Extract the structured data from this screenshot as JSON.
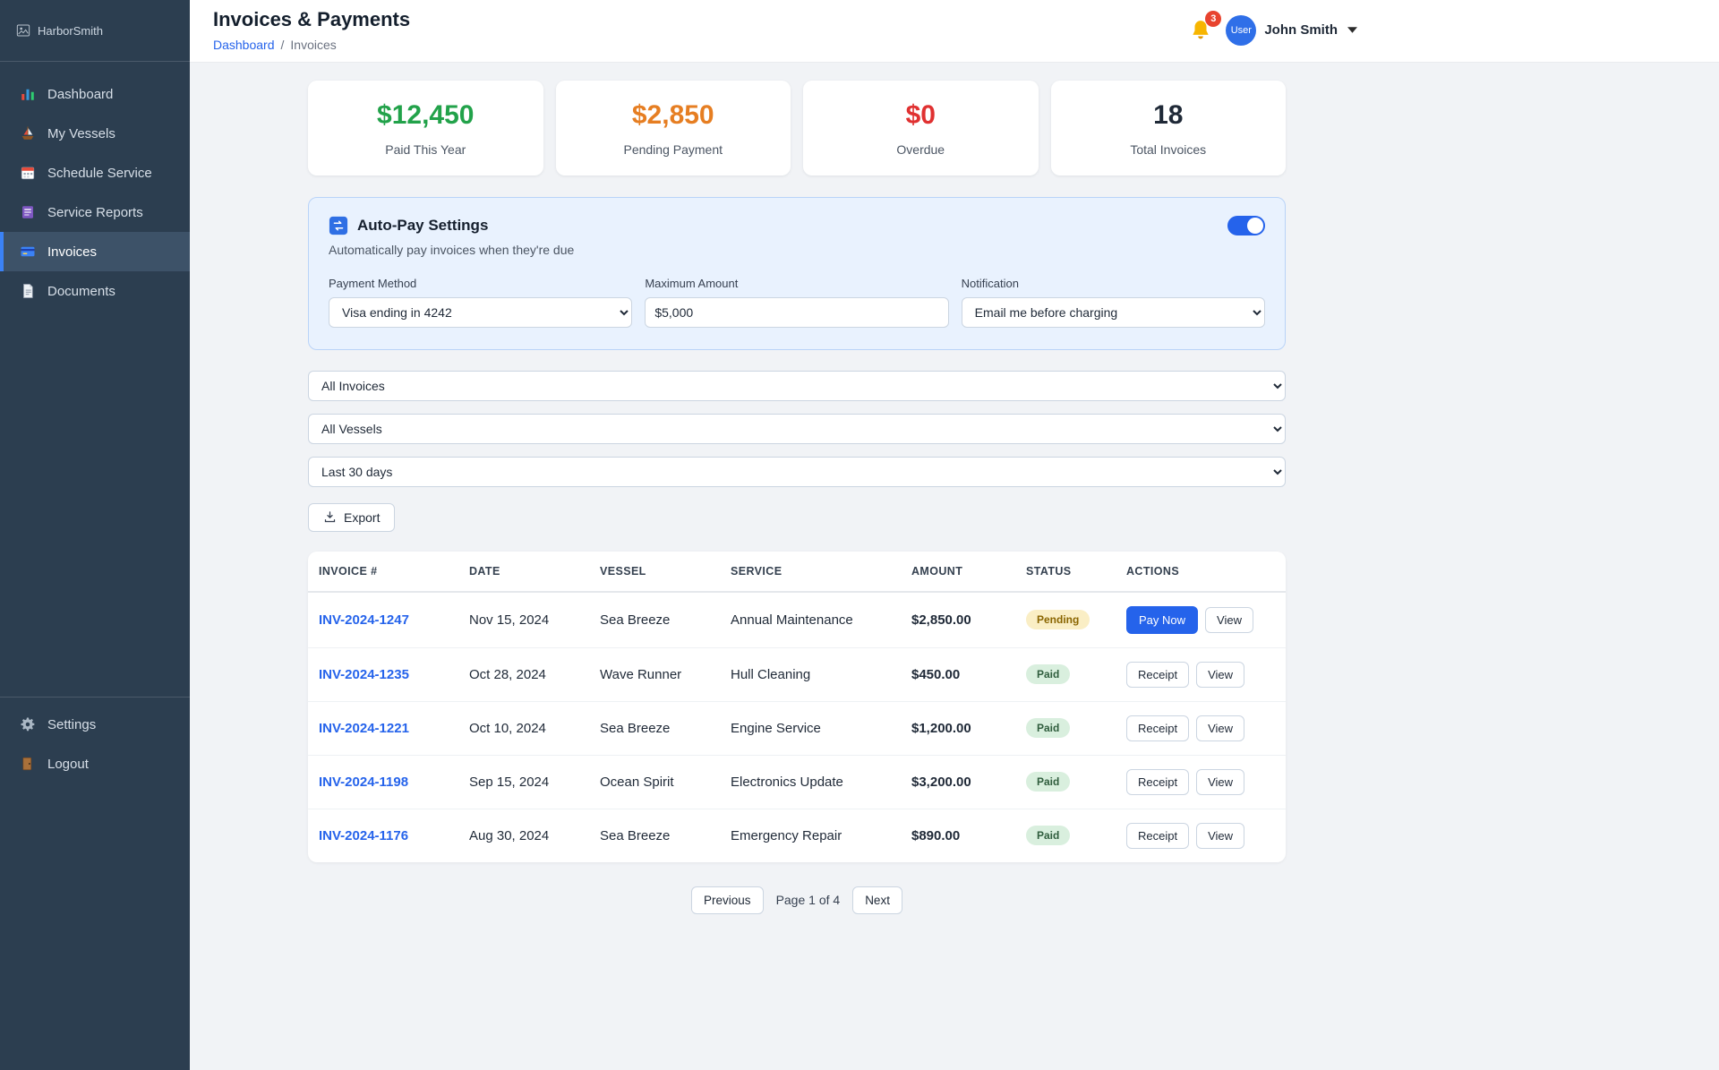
{
  "brand": {
    "name": "HarborSmith"
  },
  "header": {
    "title": "Invoices & Payments",
    "breadcrumb": {
      "link": "Dashboard",
      "separator": "/",
      "current": "Invoices"
    },
    "notification_count": "3",
    "user_name": "John Smith",
    "avatar_text": "User"
  },
  "sidebar": {
    "items": [
      {
        "label": "Dashboard",
        "icon": "dashboard-icon",
        "active": false
      },
      {
        "label": "My Vessels",
        "icon": "vessel-icon",
        "active": false
      },
      {
        "label": "Schedule Service",
        "icon": "calendar-icon",
        "active": false
      },
      {
        "label": "Service Reports",
        "icon": "report-icon",
        "active": false
      },
      {
        "label": "Invoices",
        "icon": "invoice-icon",
        "active": true
      },
      {
        "label": "Documents",
        "icon": "document-icon",
        "active": false
      }
    ],
    "footer_items": [
      {
        "label": "Settings",
        "icon": "gear-icon",
        "active": false
      },
      {
        "label": "Logout",
        "icon": "door-icon",
        "active": false
      }
    ]
  },
  "stats": [
    {
      "value": "$12,450",
      "label": "Paid This Year",
      "color": "#22a24a"
    },
    {
      "value": "$2,850",
      "label": "Pending Payment",
      "color": "#e67e22"
    },
    {
      "value": "$0",
      "label": "Overdue",
      "color": "#e03131"
    },
    {
      "value": "18",
      "label": "Total Invoices",
      "color": "#1f2937"
    }
  ],
  "autopay": {
    "title": "Auto-Pay Settings",
    "subtitle": "Automatically pay invoices when they're due",
    "toggle_on": true,
    "fields": [
      {
        "label": "Payment Method",
        "type": "select",
        "value": "Visa ending in 4242"
      },
      {
        "label": "Maximum Amount",
        "type": "input",
        "value": "$5,000"
      },
      {
        "label": "Notification",
        "type": "select",
        "value": "Email me before charging"
      }
    ]
  },
  "filters": [
    {
      "name": "invoice-status-filter",
      "value": "All Invoices"
    },
    {
      "name": "vessel-filter",
      "value": "All Vessels"
    },
    {
      "name": "date-range-filter",
      "value": "Last 30 days"
    }
  ],
  "export_label": "Export",
  "invoice_table": {
    "columns": [
      "INVOICE #",
      "DATE",
      "VESSEL",
      "SERVICE",
      "AMOUNT",
      "STATUS",
      "ACTIONS"
    ],
    "rows": [
      {
        "invoice": "INV-2024-1247",
        "date": "Nov 15, 2024",
        "vessel": "Sea Breeze",
        "service": "Annual Maintenance",
        "amount": "$2,850.00",
        "status": "Pending",
        "actions": [
          {
            "label": "Pay Now",
            "variant": "primary"
          },
          {
            "label": "View",
            "variant": "default"
          }
        ]
      },
      {
        "invoice": "INV-2024-1235",
        "date": "Oct 28, 2024",
        "vessel": "Wave Runner",
        "service": "Hull Cleaning",
        "amount": "$450.00",
        "status": "Paid",
        "actions": [
          {
            "label": "Receipt",
            "variant": "default"
          },
          {
            "label": "View",
            "variant": "default"
          }
        ]
      },
      {
        "invoice": "INV-2024-1221",
        "date": "Oct 10, 2024",
        "vessel": "Sea Breeze",
        "service": "Engine Service",
        "amount": "$1,200.00",
        "status": "Paid",
        "actions": [
          {
            "label": "Receipt",
            "variant": "default"
          },
          {
            "label": "View",
            "variant": "default"
          }
        ]
      },
      {
        "invoice": "INV-2024-1198",
        "date": "Sep 15, 2024",
        "vessel": "Ocean Spirit",
        "service": "Electronics Update",
        "amount": "$3,200.00",
        "status": "Paid",
        "actions": [
          {
            "label": "Receipt",
            "variant": "default"
          },
          {
            "label": "View",
            "variant": "default"
          }
        ]
      },
      {
        "invoice": "INV-2024-1176",
        "date": "Aug 30, 2024",
        "vessel": "Sea Breeze",
        "service": "Emergency Repair",
        "amount": "$890.00",
        "status": "Paid",
        "actions": [
          {
            "label": "Receipt",
            "variant": "default"
          },
          {
            "label": "View",
            "variant": "default"
          }
        ]
      }
    ]
  },
  "pagination": {
    "previous": "Previous",
    "label": "Page 1 of 4",
    "next": "Next"
  }
}
